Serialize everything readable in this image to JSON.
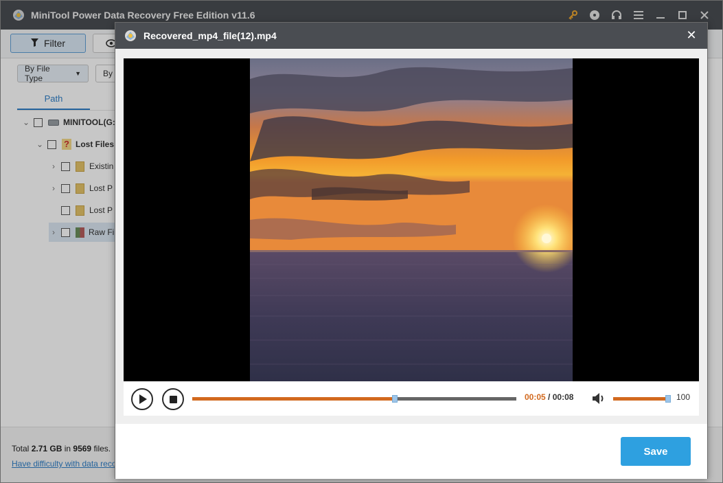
{
  "app": {
    "title": "MiniTool Power Data Recovery Free Edition v11.6",
    "icons": [
      "key-icon",
      "disc-icon",
      "headset-icon",
      "menu-icon",
      "minimize-icon",
      "maximize-icon",
      "close-icon"
    ]
  },
  "toolbar": {
    "filter_label": "Filter"
  },
  "subbar": {
    "by_file_type": "By File Type",
    "by_other": "By"
  },
  "tree": {
    "tab_path": "Path",
    "items": [
      {
        "label": "MINITOOL(G: I"
      },
      {
        "label": "Lost Files"
      },
      {
        "label": "Existin"
      },
      {
        "label": "Lost P"
      },
      {
        "label": "Lost P"
      },
      {
        "label": "Raw Fi"
      }
    ]
  },
  "status": {
    "total_prefix": "Total ",
    "total_size": "2.71 GB",
    "total_mid": " in ",
    "total_count": "9569",
    "total_suffix": " files.",
    "help_link": "Have difficulty with data reco"
  },
  "dialog": {
    "title": "Recovered_mp4_file(12).mp4",
    "save_label": "Save"
  },
  "player": {
    "current_time": "00:05",
    "separator": " / ",
    "total_time": "00:08",
    "progress": 0.625,
    "volume": 100,
    "volume_label": "100"
  },
  "colors": {
    "accent_orange": "#d2691e",
    "save_blue": "#2ea0e0",
    "header_dark": "#4a4d52"
  }
}
